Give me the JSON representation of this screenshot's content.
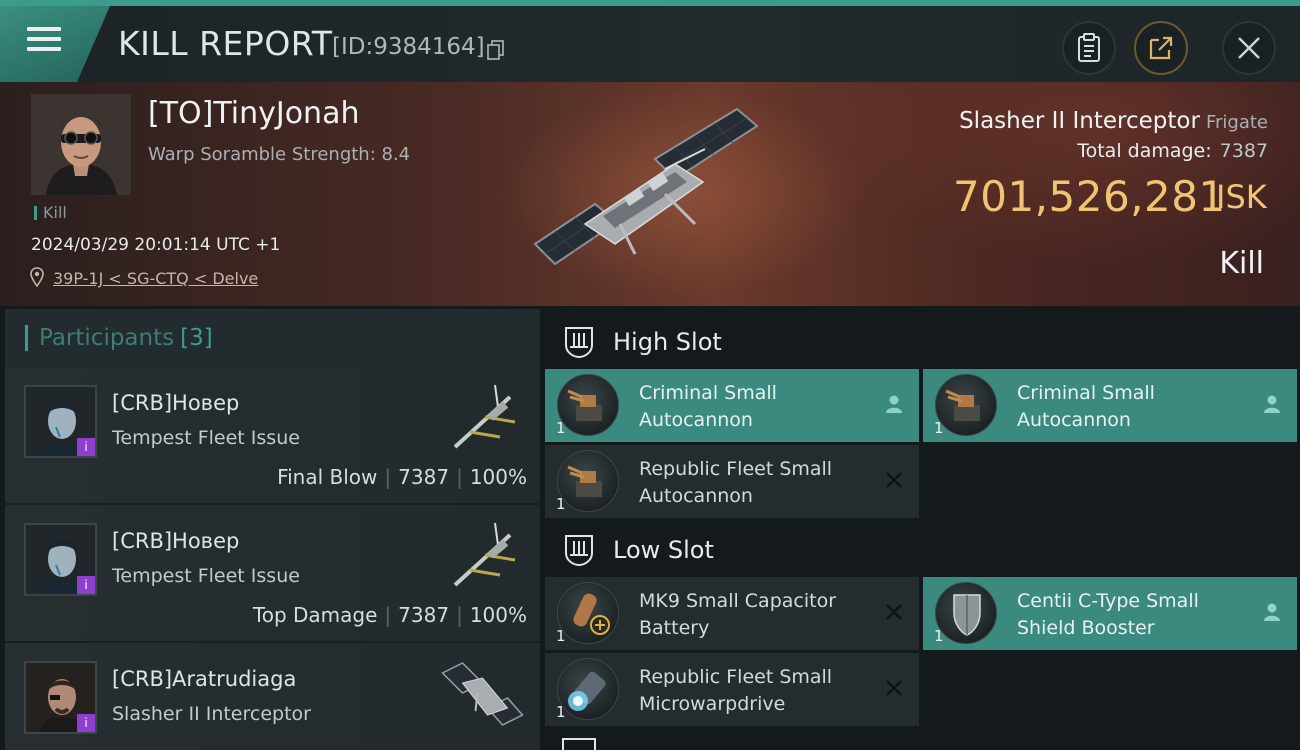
{
  "header": {
    "title": "KILL REPORT",
    "kill_id": "[ID:9384164]"
  },
  "victim": {
    "name": "[TO]TinyJonah",
    "scramble": "Warp Soramble Strength: 8.4",
    "tag": "Kill",
    "time": "2024/03/29 20:01:14 UTC +1",
    "location": "39P-1J < SG-CTQ < Delve",
    "ship_name": "Slasher II Interceptor",
    "ship_class": "Frigate",
    "total_damage_label": "Total damage:",
    "total_damage": "7387",
    "isk_value": "701,526,281",
    "isk_unit": "ISK",
    "result": "Kill"
  },
  "participants": {
    "label": "Participants",
    "count": "[3]",
    "rows": [
      {
        "name": "[CRB]Новер",
        "ship": "Tempest Fleet Issue",
        "role": "Final Blow",
        "damage": "7387",
        "percent": "100%"
      },
      {
        "name": "[CRB]Новер",
        "ship": "Tempest Fleet Issue",
        "role": "Top Damage",
        "damage": "7387",
        "percent": "100%"
      },
      {
        "name": "[CRB]Aratrudiaga",
        "ship": "Slasher II Interceptor",
        "role": "",
        "damage": "",
        "percent": ""
      }
    ]
  },
  "slots": {
    "high": {
      "label": "High Slot",
      "modules": [
        {
          "line1": "Criminal Small",
          "line2": "Autocannon",
          "qty": "1",
          "state": "fitted"
        },
        {
          "line1": "Criminal Small",
          "line2": "Autocannon",
          "qty": "1",
          "state": "fitted"
        },
        {
          "line1": "Republic Fleet Small",
          "line2": "Autocannon",
          "qty": "1",
          "state": "destroyed"
        }
      ]
    },
    "low": {
      "label": "Low Slot",
      "modules": [
        {
          "line1": "MK9 Small Capacitor",
          "line2": "Battery",
          "qty": "1",
          "state": "destroyed"
        },
        {
          "line1": "Centii C-Type Small",
          "line2": "Shield Booster",
          "qty": "1",
          "state": "fitted"
        },
        {
          "line1": "Republic Fleet Small",
          "line2": "Microwarpdrive",
          "qty": "1",
          "state": "destroyed"
        }
      ]
    }
  },
  "colors": {
    "accent": "#3a9c8c",
    "isk": "#f0c473",
    "fitted_bg": "#3b8a80",
    "destroyed_bg": "#242c2f",
    "badge": "#8e3fd0"
  },
  "icons": [
    "menu-icon",
    "copy-icon",
    "clipboard-icon",
    "share-icon",
    "close-icon",
    "location-pin-icon",
    "high-slot-icon",
    "low-slot-icon",
    "pilot-icon",
    "cross-icon"
  ]
}
